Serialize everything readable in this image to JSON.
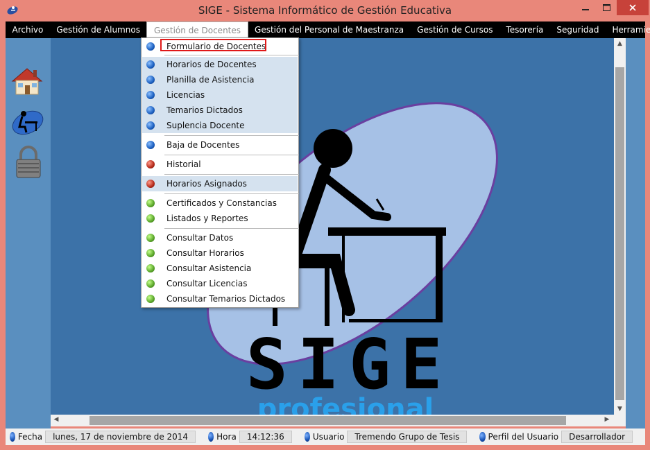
{
  "window": {
    "title": "SIGE - Sistema Informático de Gestión Educativa"
  },
  "menubar": {
    "items": [
      {
        "label": "Archivo"
      },
      {
        "label": "Gestión de  Alumnos"
      },
      {
        "label": "Gestión de Docentes"
      },
      {
        "label": "Gestión del Personal de Maestranza"
      },
      {
        "label": "Gestión de Cursos"
      },
      {
        "label": "Tesorería"
      },
      {
        "label": "Seguridad"
      },
      {
        "label": "Herramientas"
      }
    ]
  },
  "dropdown": {
    "items": [
      {
        "label": "Formulario de Docentes",
        "dot": "blue"
      },
      {
        "label": "Horarios de Docentes",
        "dot": "blue"
      },
      {
        "label": "Planilla de Asistencia",
        "dot": "blue"
      },
      {
        "label": "Licencias",
        "dot": "blue"
      },
      {
        "label": "Temarios Dictados",
        "dot": "blue"
      },
      {
        "label": "Suplencia Docente",
        "dot": "blue"
      },
      {
        "label": "Baja de Docentes",
        "dot": "blue"
      },
      {
        "label": "Historial",
        "dot": "red"
      },
      {
        "label": "Horarios Asignados",
        "dot": "red"
      },
      {
        "label": "Certificados y Constancias",
        "dot": "green"
      },
      {
        "label": "Listados y Reportes",
        "dot": "green"
      },
      {
        "label": "Consultar Datos",
        "dot": "green"
      },
      {
        "label": "Consultar Horarios",
        "dot": "green"
      },
      {
        "label": "Consultar Asistencia",
        "dot": "green"
      },
      {
        "label": "Consultar Licencias",
        "dot": "green"
      },
      {
        "label": "Consultar Temarios Dictados",
        "dot": "green"
      }
    ]
  },
  "logo": {
    "text": "SIGE",
    "subtext": "profesional"
  },
  "sidebar": {
    "icons": [
      "home-icon",
      "teacher-desk-icon",
      "padlock-icon"
    ]
  },
  "statusbar": {
    "fecha_label": "Fecha",
    "fecha_value": "lunes, 17 de noviembre de 2014",
    "hora_label": "Hora",
    "hora_value": "14:12:36",
    "usuario_label": "Usuario",
    "usuario_value": "Tremendo Grupo de Tesis",
    "perfil_label": "Perfil del Usuario",
    "perfil_value": "Desarrollador"
  },
  "colors": {
    "frame": "#e9877a",
    "menubar": "#000000",
    "canvas": "#3c72a8",
    "highlight": "#e01818"
  }
}
